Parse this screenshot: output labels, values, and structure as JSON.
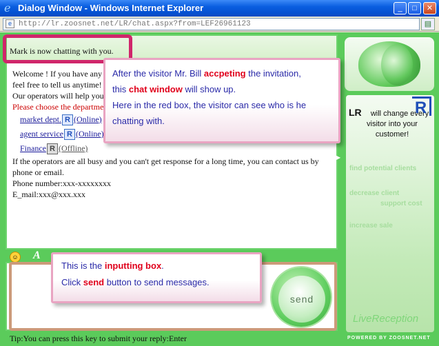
{
  "window": {
    "title": "Dialog Window - Windows Internet Explorer",
    "url": "http://lr.zoosnet.net/LR/chat.aspx?from=LEF26961123"
  },
  "status": {
    "text": "Mark is now chatting with you."
  },
  "messages": {
    "welcome_1": "Welcome ! If you have any q",
    "welcome_2": "feel free to tell us anytime!",
    "welcome_3": "Our operators will help you",
    "choose": "Please choose the departmen",
    "departments": [
      {
        "name": "market dept.",
        "status": "(Online)"
      },
      {
        "name": "agent service",
        "status": "(Online)"
      },
      {
        "name": "Finance",
        "status": "(Offline)"
      }
    ],
    "busy": "If the operators are all busy and you can't get response for a long time, you can contact us by phone or email.",
    "phone": "Phone number:xxx-xxxxxxxx",
    "email": "E_mail:xxx@xxx.xxx"
  },
  "input": {
    "send_label": "send",
    "tip": "Tip:You can press this key to submit your reply:Enter"
  },
  "sidebar": {
    "ad_title": "LR",
    "ad_slogan": "will change every visitor into your customer!",
    "ad_logo": "R",
    "faded_lines": [
      "find potential clients",
      "decrease client",
      "support cost",
      "increase sale"
    ],
    "brand": "LiveReception",
    "powered": "POWERED BY ZOOSNET.NET"
  },
  "notes": {
    "top": {
      "l1_pre": "After the visitor Mr. Bill ",
      "l1_hl": "accpeting",
      "l1_post": " the invitation,",
      "l2_pre": "this ",
      "l2_hl": "chat window",
      "l2_post": " will show up.",
      "l3": "Here in the red box, the visitor can see who is he",
      "l4": "chatting with."
    },
    "bottom": {
      "l1_pre": "This is the ",
      "l1_hl": "inputting box",
      "l1_post": ".",
      "l2_pre": "Click ",
      "l2_hl": "send",
      "l2_post": " button to send messages."
    }
  },
  "colors": {
    "frame_green": "#5bcb5b",
    "highlight_red": "#d0266b",
    "note_text": "#2a2aa8",
    "note_highlight": "#e0001b"
  }
}
